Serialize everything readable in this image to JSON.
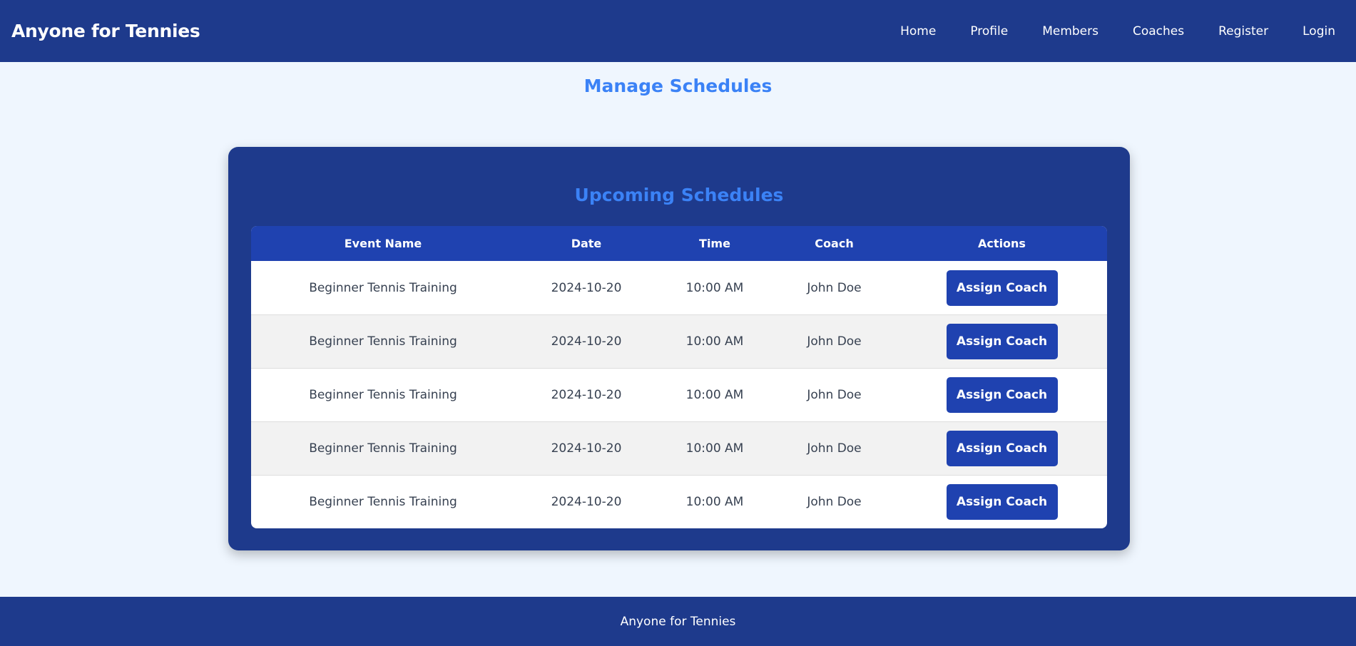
{
  "header": {
    "brand": "Anyone for Tennies",
    "nav": [
      {
        "label": "Home"
      },
      {
        "label": "Profile"
      },
      {
        "label": "Members"
      },
      {
        "label": "Coaches"
      },
      {
        "label": "Register"
      },
      {
        "label": "Login"
      }
    ]
  },
  "main": {
    "title": "Manage Schedules",
    "card_title": "Upcoming Schedules",
    "table": {
      "headers": [
        "Event Name",
        "Date",
        "Time",
        "Coach",
        "Actions"
      ],
      "rows": [
        {
          "event": "Beginner Tennis Training",
          "date": "2024-10-20",
          "time": "10:00 AM",
          "coach": "John Doe",
          "action": "Assign Coach"
        },
        {
          "event": "Beginner Tennis Training",
          "date": "2024-10-20",
          "time": "10:00 AM",
          "coach": "John Doe",
          "action": "Assign Coach"
        },
        {
          "event": "Beginner Tennis Training",
          "date": "2024-10-20",
          "time": "10:00 AM",
          "coach": "John Doe",
          "action": "Assign Coach"
        },
        {
          "event": "Beginner Tennis Training",
          "date": "2024-10-20",
          "time": "10:00 AM",
          "coach": "John Doe",
          "action": "Assign Coach"
        },
        {
          "event": "Beginner Tennis Training",
          "date": "2024-10-20",
          "time": "10:00 AM",
          "coach": "John Doe",
          "action": "Assign Coach"
        }
      ]
    }
  },
  "footer": {
    "text": "Anyone for Tennies"
  },
  "colors": {
    "navbar": "#1e3a8c",
    "page_background": "#eff6fe",
    "accent": "#3b82f6",
    "button": "#1f42b0"
  }
}
